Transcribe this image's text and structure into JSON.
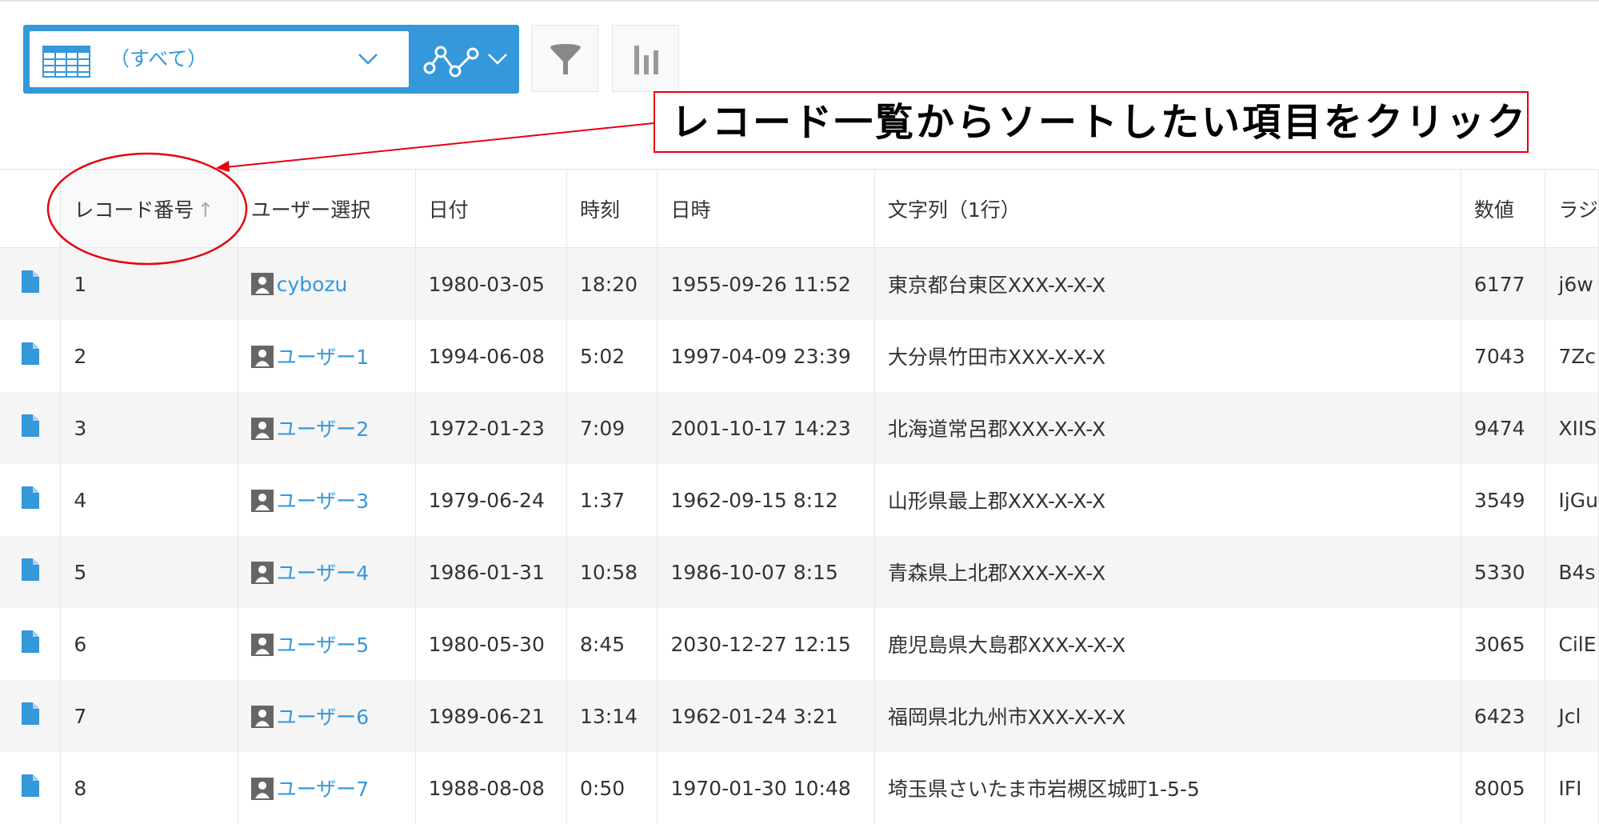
{
  "view": {
    "selected_label": "（すべて）",
    "accent_color": "#3498db"
  },
  "icons": {
    "view_list": "table-icon",
    "graph": "line-graph-icon",
    "filter": "funnel-icon",
    "chart": "bar-chart-icon",
    "record_detail": "document-icon",
    "user": "user-avatar-icon"
  },
  "annotation": {
    "text": "レコード一覧からソートしたい項目をクリック",
    "color": "#e60012"
  },
  "table": {
    "columns": [
      "レコード番号",
      "ユーザー選択",
      "日付",
      "時刻",
      "日時",
      "文字列（1行）",
      "数値",
      "ラジ"
    ],
    "sort_indicator": "↑",
    "rows": [
      {
        "record_no": "1",
        "user": "cybozu",
        "date": "1980-03-05",
        "time": "18:20",
        "datetime": "1955-09-26 11:52",
        "text": "東京都台東区XXX-X-X-X",
        "number": "6177",
        "radio": "j6w"
      },
      {
        "record_no": "2",
        "user": "ユーザー1",
        "date": "1994-06-08",
        "time": "5:02",
        "datetime": "1997-04-09 23:39",
        "text": "大分県竹田市XXX-X-X-X",
        "number": "7043",
        "radio": "7Zc"
      },
      {
        "record_no": "3",
        "user": "ユーザー2",
        "date": "1972-01-23",
        "time": "7:09",
        "datetime": "2001-10-17 14:23",
        "text": "北海道常呂郡XXX-X-X-X",
        "number": "9474",
        "radio": "XIIS"
      },
      {
        "record_no": "4",
        "user": "ユーザー3",
        "date": "1979-06-24",
        "time": "1:37",
        "datetime": "1962-09-15 8:12",
        "text": "山形県最上郡XXX-X-X-X",
        "number": "3549",
        "radio": "IjGu"
      },
      {
        "record_no": "5",
        "user": "ユーザー4",
        "date": "1986-01-31",
        "time": "10:58",
        "datetime": "1986-10-07 8:15",
        "text": "青森県上北郡XXX-X-X-X",
        "number": "5330",
        "radio": "B4s"
      },
      {
        "record_no": "6",
        "user": "ユーザー5",
        "date": "1980-05-30",
        "time": "8:45",
        "datetime": "2030-12-27 12:15",
        "text": "鹿児島県大島郡XXX-X-X-X",
        "number": "3065",
        "radio": "CilE"
      },
      {
        "record_no": "7",
        "user": "ユーザー6",
        "date": "1989-06-21",
        "time": "13:14",
        "datetime": "1962-01-24 3:21",
        "text": "福岡県北九州市XXX-X-X-X",
        "number": "6423",
        "radio": "Jcl"
      },
      {
        "record_no": "8",
        "user": "ユーザー7",
        "date": "1988-08-08",
        "time": "0:50",
        "datetime": "1970-01-30 10:48",
        "text": "埼玉県さいたま市岩槻区城町1-5-5",
        "number": "8005",
        "radio": "IFI"
      }
    ]
  }
}
